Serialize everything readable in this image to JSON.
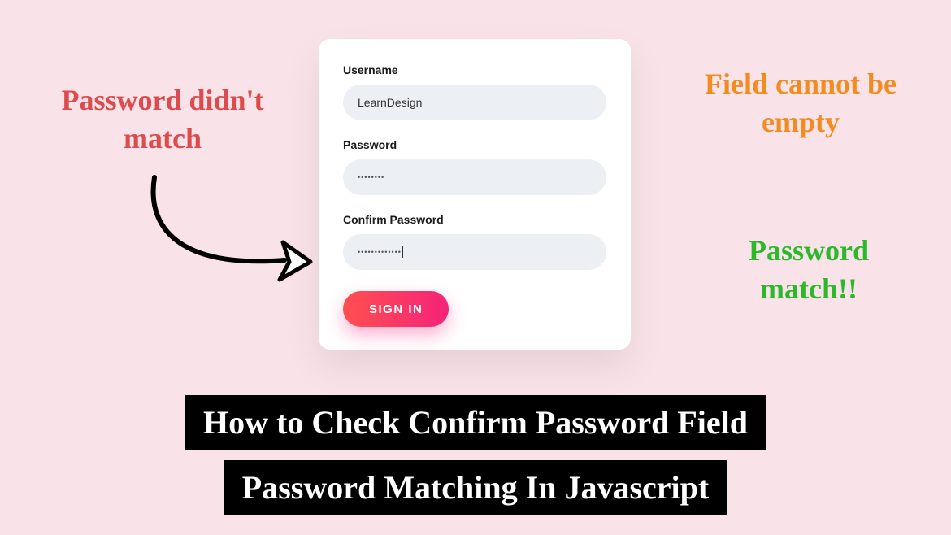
{
  "annotations": {
    "error_mismatch": "Password didn't match",
    "error_empty": "Field cannot be empty",
    "success_match": "Password match!!"
  },
  "form": {
    "username_label": "Username",
    "username_value": "LearnDesign",
    "password_label": "Password",
    "password_value": "••••••••",
    "confirm_label": "Confirm Password",
    "confirm_value": "•••••••••••••",
    "submit_label": "SIGN IN"
  },
  "title": {
    "line1": "How to Check Confirm Password Field",
    "line2": "Password Matching In Javascript"
  },
  "colors": {
    "error": "#dc4c4c",
    "warning": "#f28c1f",
    "success": "#2bb82b",
    "button_gradient_start": "#ff4f4f",
    "button_gradient_end": "#f5237a"
  }
}
